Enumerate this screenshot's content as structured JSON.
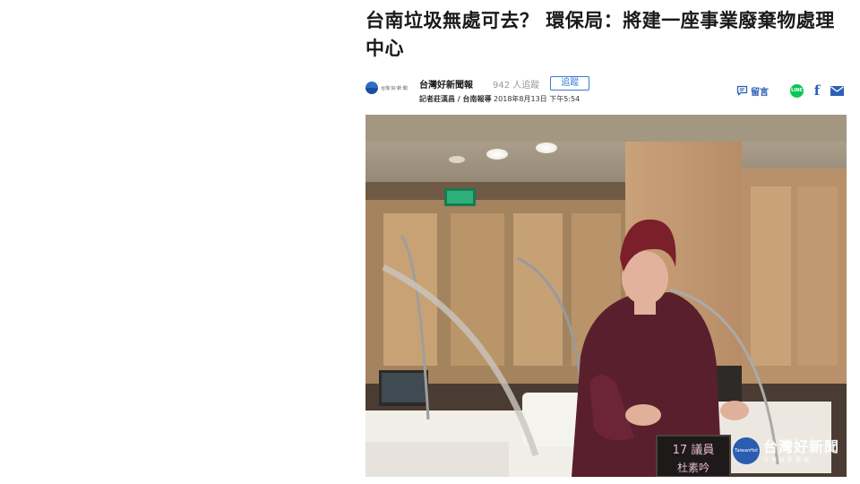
{
  "article": {
    "headline": "台南垃圾無處可去？ 環保局：將建一座事業廢棄物處理中心",
    "source": {
      "logo_text": "台灣‧好‧新‧聞",
      "name": "台灣好新聞報",
      "follow_count": "942 人追蹤",
      "follow_label": "追蹤"
    },
    "byline": {
      "reporter": "記者莊漢昌 / 台南報導",
      "datetime": "2018年8月13日 下午5:54"
    },
    "share": {
      "comment_label": "留言",
      "line_label": "LINE",
      "facebook_glyph": "f"
    },
    "photo": {
      "nameplate_line1": "17 議員",
      "nameplate_line2": "杜素吟",
      "watermark_logo": "TaiwanHot",
      "watermark_text": "台灣好新聞",
      "watermark_sub": "台灣好新聞報"
    }
  },
  "colors": {
    "accent": "#2d5fb8",
    "line_green": "#06c755",
    "headline": "#1a1a1a"
  }
}
